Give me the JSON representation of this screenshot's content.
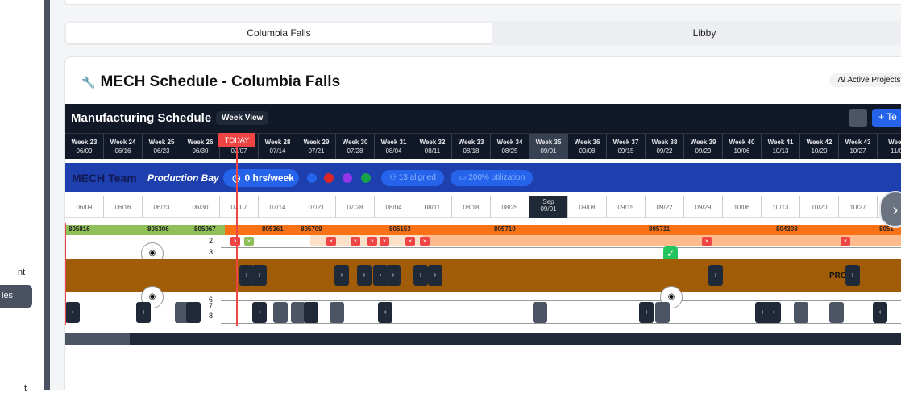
{
  "sidebar": {
    "item_partial_1": "nt",
    "item_active": "les",
    "item_partial_2": "t"
  },
  "location_tabs": [
    {
      "label": "Columbia Falls",
      "active": true
    },
    {
      "label": "Libby",
      "active": false
    }
  ],
  "card": {
    "title": "MECH Schedule - Columbia Falls",
    "active_projects": "79 Active Projects"
  },
  "schedule": {
    "title": "Manufacturing Schedule",
    "view_label": "Week View",
    "add_label": "+ Te",
    "today_label": "TODAY",
    "weeks": [
      {
        "week": "Week 23",
        "date": "06/09"
      },
      {
        "week": "Week 24",
        "date": "06/16"
      },
      {
        "week": "Week 25",
        "date": "06/23"
      },
      {
        "week": "Week 26",
        "date": "06/30"
      },
      {
        "week": "Week 27",
        "date": "07/07"
      },
      {
        "week": "Week 28",
        "date": "07/14"
      },
      {
        "week": "Week 29",
        "date": "07/21"
      },
      {
        "week": "Week 30",
        "date": "07/28"
      },
      {
        "week": "Week 31",
        "date": "08/04"
      },
      {
        "week": "Week 32",
        "date": "08/11"
      },
      {
        "week": "Week 33",
        "date": "08/18"
      },
      {
        "week": "Week 34",
        "date": "08/25"
      },
      {
        "week": "Week 35",
        "date": "09/01"
      },
      {
        "week": "Week 36",
        "date": "09/08"
      },
      {
        "week": "Week 37",
        "date": "09/15"
      },
      {
        "week": "Week 38",
        "date": "09/22"
      },
      {
        "week": "Week 39",
        "date": "09/29"
      },
      {
        "week": "Week 40",
        "date": "10/06"
      },
      {
        "week": "Week 41",
        "date": "10/13"
      },
      {
        "week": "Week 42",
        "date": "10/20"
      },
      {
        "week": "Week 43",
        "date": "10/27"
      },
      {
        "week": "Week",
        "date": "11/0"
      }
    ],
    "team": {
      "name": "MECH Team",
      "bay": "Production Bay",
      "hours": "0 hrs/week",
      "aligned": "13 aligned",
      "utilization": "200% utilization"
    },
    "dates": [
      "06/09",
      "06/16",
      "06/23",
      "06/30",
      "07/07",
      "07/14",
      "07/21",
      "07/28",
      "08/04",
      "08/11",
      "08/18",
      "08/25",
      "Sep",
      "09/08",
      "09/15",
      "09/22",
      "09/29",
      "10/06",
      "10/13",
      "10/20",
      "10/27"
    ],
    "current_date_sub": "09/01",
    "project_labels": [
      "805816",
      "805306",
      "805067",
      "805361",
      "805709",
      "805153",
      "805710",
      "805711",
      "804308",
      "8051"
    ],
    "row_numbers": [
      "2",
      "3",
      "6",
      "7",
      "8"
    ],
    "pro_label": "PRO",
    "colors": {
      "header": "#111827",
      "team": "#1e40af",
      "orange": "#f97316",
      "brown": "#a15c07",
      "today": "#ef4444"
    }
  }
}
